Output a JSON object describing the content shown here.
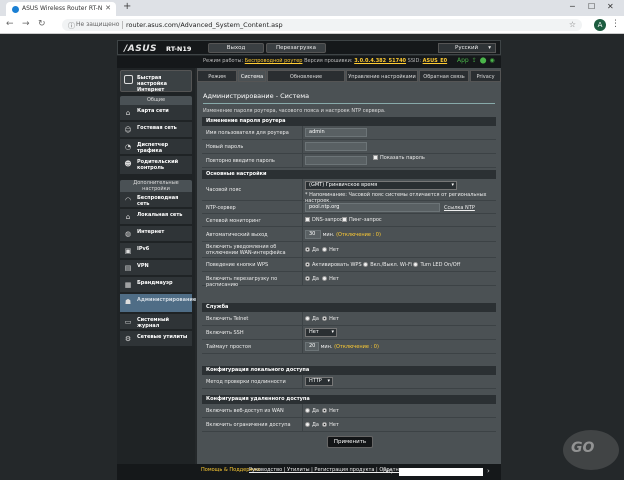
{
  "browser": {
    "tab_title": "ASUS Wireless Router RT-N19 - С",
    "url_security": "Не защищено",
    "url": "router.asus.com/Advanced_System_Content.asp",
    "avatar_letter": "A"
  },
  "header": {
    "logo": "/ASUS",
    "model": "RT-N19",
    "logout": "Выход",
    "reboot": "Перезагрузка",
    "language": "Русский",
    "status_mode_label": "Режим работы:",
    "status_mode_value": "Беспроводной роутер",
    "status_fw_label": "Версия прошивки:",
    "status_fw_value": "3.0.0.4.382_51740",
    "status_ssid_label": "SSID:",
    "status_ssid_value": "ASUS_E0",
    "app_label": "App"
  },
  "sidebar": {
    "qis": "Быстрая настройка Интернет",
    "general_title": "Общие",
    "general": [
      {
        "label": "Карта сети",
        "icon": "map-icon"
      },
      {
        "label": "Гостевая сеть",
        "icon": "guest-icon"
      },
      {
        "label": "Диспетчер трафика",
        "icon": "traffic-icon"
      },
      {
        "label": "Родительский контроль",
        "icon": "parental-icon"
      }
    ],
    "advanced_title": "Дополнительные настройки",
    "advanced": [
      {
        "label": "Беспроводная сеть",
        "icon": "wifi-icon"
      },
      {
        "label": "Локальная сеть",
        "icon": "lan-icon"
      },
      {
        "label": "Интернет",
        "icon": "globe-icon"
      },
      {
        "label": "IPv6",
        "icon": "ipv6-icon"
      },
      {
        "label": "VPN",
        "icon": "vpn-icon"
      },
      {
        "label": "Брандмауэр",
        "icon": "firewall-icon"
      },
      {
        "label": "Администрирование",
        "icon": "admin-icon"
      },
      {
        "label": "Системный журнал",
        "icon": "log-icon"
      },
      {
        "label": "Сетевые утилиты",
        "icon": "tools-icon"
      }
    ]
  },
  "tabs": [
    "Режим работы",
    "Система",
    "Обновление микропрограммы",
    "Управление настройками",
    "Обратная связь",
    "Privacy"
  ],
  "page": {
    "title": "Администрирование - Система",
    "desc": "Изменение пароля роутера, часового пояса и настроек NTP сервера."
  },
  "sec_password": {
    "title": "Изменение пароля роутера",
    "username_label": "Имя пользователя для роутера",
    "username_value": "admin",
    "newpass_label": "Новый пароль",
    "repeat_label": "Повторно введите пароль",
    "show_password": "Показать пароль"
  },
  "sec_basic": {
    "title": "Основные настройки",
    "tz_label": "Часовой пояс",
    "tz_value": "(GMT) Гринвичское время",
    "tz_hint": "* Напоминание: Часовой пояс системы отличается от региональных настроек.",
    "ntp_label": "NTP-сервер",
    "ntp_value": "pool.ntp.org",
    "ntp_link": "Ссылка NTP",
    "netmon_label": "Сетевой мониторинг",
    "dns_query": "DNS-запрос",
    "ping_query": "Пинг-запрос",
    "autologout_label": "Автоматический выход",
    "autologout_value": "30",
    "autologout_unit": "мин.",
    "autologout_hint": "(Отключение : 0)",
    "wan_notify_label": "Включить уведомления об отключении WAN-интерфейса",
    "yes": "Да",
    "no": "Нет",
    "wps_label": "Поведение кнопки WPS",
    "wps_opt1": "Активировать WPS",
    "wps_opt2": "Вкл./Выкл. Wi-Fi",
    "wps_opt3": "Turn LED On/Off",
    "reboot_sched_label": "Включить перезагрузку по расписанию"
  },
  "sec_service": {
    "title": "Служба",
    "telnet_label": "Включить Telnet",
    "ssh_label": "Включить SSH",
    "ssh_value": "Нет",
    "idle_label": "Таймаут простоя",
    "idle_value": "20",
    "idle_unit": "мин.",
    "idle_hint": "(Отключение : 0)"
  },
  "sec_local": {
    "title": "Конфигурация локального доступа",
    "auth_label": "Метод проверки подлинности",
    "auth_value": "HTTP"
  },
  "sec_remote": {
    "title": "Конфигурация удаленного доступа",
    "webwan_label": "Включить веб-доступ из WAN",
    "restrict_label": "Включить ограничения доступа"
  },
  "apply": "Применить",
  "footer": {
    "help": "Помощь & Поддержка",
    "links": "Руководство | Утилиты | Регистрация продукта | Обратная связь",
    "faq": "FAQ"
  },
  "watermark": "GO"
}
